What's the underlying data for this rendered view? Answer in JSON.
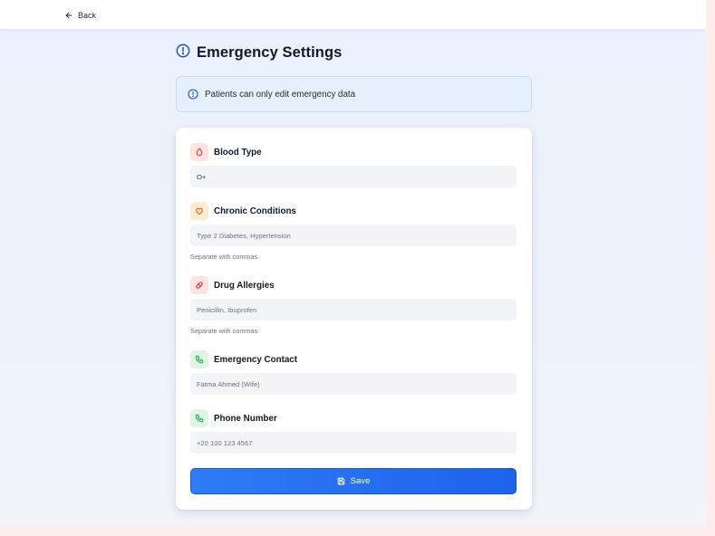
{
  "nav": {
    "back_label": "Back"
  },
  "page": {
    "title": "Emergency Settings"
  },
  "notice": {
    "text": "Patients can only edit emergency data"
  },
  "form": {
    "blood_type": {
      "label": "Blood Type",
      "value": "O+"
    },
    "chronic": {
      "label": "Chronic Conditions",
      "placeholder": "Type 2 Diabetes, Hypertension",
      "hint": "Separate with commas"
    },
    "allergies": {
      "label": "Drug Allergies",
      "placeholder": "Penicillin, Ibuprofen",
      "hint": "Separate with commas"
    },
    "contact": {
      "label": "Emergency Contact",
      "placeholder": "Fatma Ahmed (Wife)"
    },
    "phone": {
      "label": "Phone Number",
      "placeholder": "+20 100 123 4567"
    },
    "save_label": "Save"
  },
  "colors": {
    "accent": "#2563eb",
    "danger_icon": "#dc2626",
    "warning_icon": "#ea580c",
    "success_icon": "#16a34a"
  },
  "icons": {
    "back": "arrow-left-icon",
    "title": "alert-circle-icon",
    "notice": "info-circle-icon",
    "blood_type": "droplet-icon",
    "chronic": "heart-icon",
    "allergies": "pill-icon",
    "contact": "phone-icon",
    "phone": "phone-icon",
    "save": "save-icon"
  }
}
